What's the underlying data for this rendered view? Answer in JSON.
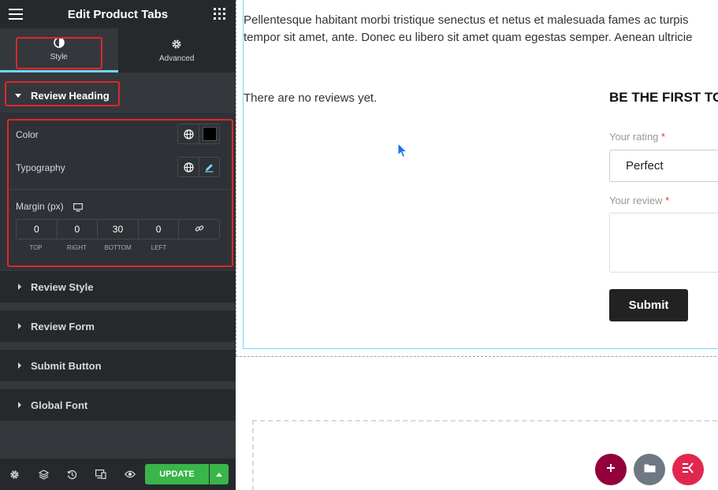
{
  "panel": {
    "title": "Edit Product Tabs",
    "tabs": [
      {
        "label": "Style",
        "icon": "style-circle-icon",
        "active": true
      },
      {
        "label": "Advanced",
        "icon": "gear-icon",
        "active": false
      }
    ],
    "open_section": {
      "label": "Review Heading",
      "controls": {
        "color_label": "Color",
        "color_value": "#000000",
        "typography_label": "Typography",
        "margin_label": "Margin (px)",
        "margin": {
          "top": "0",
          "right": "0",
          "bottom": "30",
          "left": "0",
          "top_label": "TOP",
          "right_label": "RIGHT",
          "bottom_label": "BOTTOM",
          "left_label": "LEFT"
        }
      }
    },
    "sections": [
      {
        "label": "Review Style"
      },
      {
        "label": "Review Form"
      },
      {
        "label": "Submit Button"
      },
      {
        "label": "Global Font"
      }
    ],
    "footer": {
      "update_label": "UPDATE"
    }
  },
  "canvas": {
    "paragraph_line1": "Pellentesque habitant morbi tristique senectus et netus et malesuada fames ac turpis",
    "paragraph_line2": "tempor sit amet, ante. Donec eu libero sit amet quam egestas semper. Aenean ultricie",
    "no_reviews": "There are no reviews yet.",
    "review_heading": "BE THE FIRST TO",
    "rating_label": "Your rating",
    "rating_required": "*",
    "rating_value": "Perfect",
    "review_label": "Your review",
    "review_required": "*",
    "submit_label": "Submit"
  },
  "colors": {
    "panel_bg": "#34383c",
    "panel_dark": "#26292c",
    "accent_blue": "#71d7f7",
    "update_green": "#39b54a",
    "highlight_red": "#e0262c",
    "fab_add": "#93003c",
    "fab_folder": "#6d7882",
    "fab_elementor": "#e2274f"
  }
}
